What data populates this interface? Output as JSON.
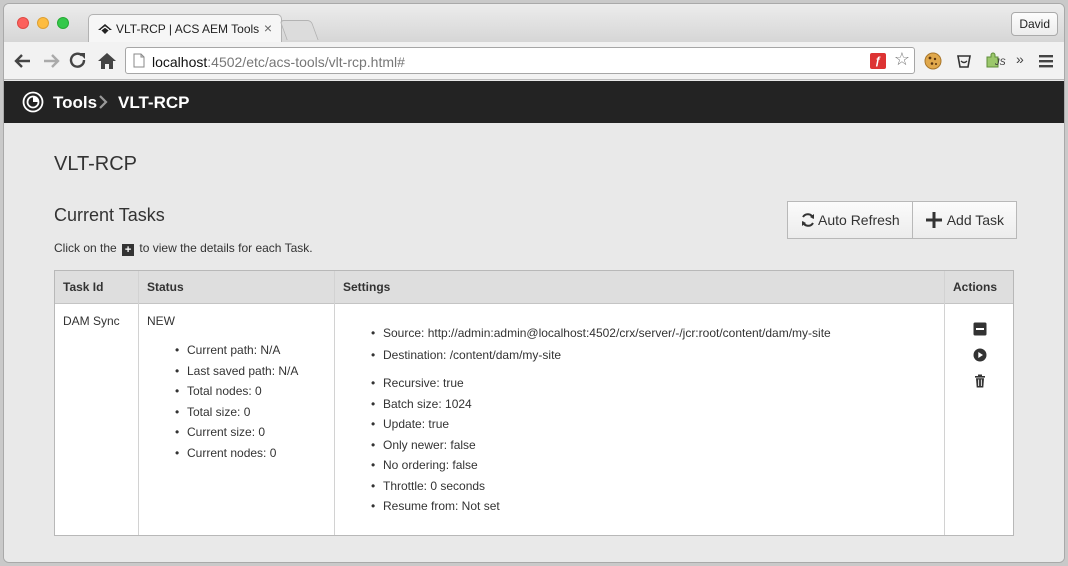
{
  "browser": {
    "tab_title": "VLT-RCP | ACS AEM Tools",
    "tab_close": "×",
    "user_label": "David",
    "url_host": "localhost",
    "url_rest": ":4502/etc/acs-tools/vlt-rcp.html#",
    "more_extensions": "»",
    "ext_js_label": "JS"
  },
  "header": {
    "breadcrumb_root": "Tools",
    "breadcrumb_current": "VLT-RCP"
  },
  "page": {
    "title": "VLT-RCP",
    "section_title": "Current Tasks",
    "hint_before": "Click on the",
    "hint_after": "to view the details for each Task."
  },
  "buttons": {
    "auto_refresh": "Auto Refresh",
    "add_task": "Add Task"
  },
  "table": {
    "columns": [
      "Task Id",
      "Status",
      "Settings",
      "Actions"
    ],
    "row": {
      "task_id": "DAM Sync",
      "status": "NEW",
      "status_details": [
        "Current path: N/A",
        "Last saved path: N/A",
        "Total nodes: 0",
        "Total size: 0",
        "Current size: 0",
        "Current nodes: 0"
      ],
      "settings_paths": [
        "Source: http://admin:admin@localhost:4502/crx/server/-/jcr:root/content/dam/my-site",
        "Destination: /content/dam/my-site"
      ],
      "settings_options": [
        "Recursive: true",
        "Batch size: 1024",
        "Update: true",
        "Only newer: false",
        "No ordering: false",
        "Throttle: 0 seconds",
        "Resume from: Not set"
      ],
      "actions": [
        "collapse-icon",
        "play-icon",
        "trash-icon"
      ]
    }
  }
}
